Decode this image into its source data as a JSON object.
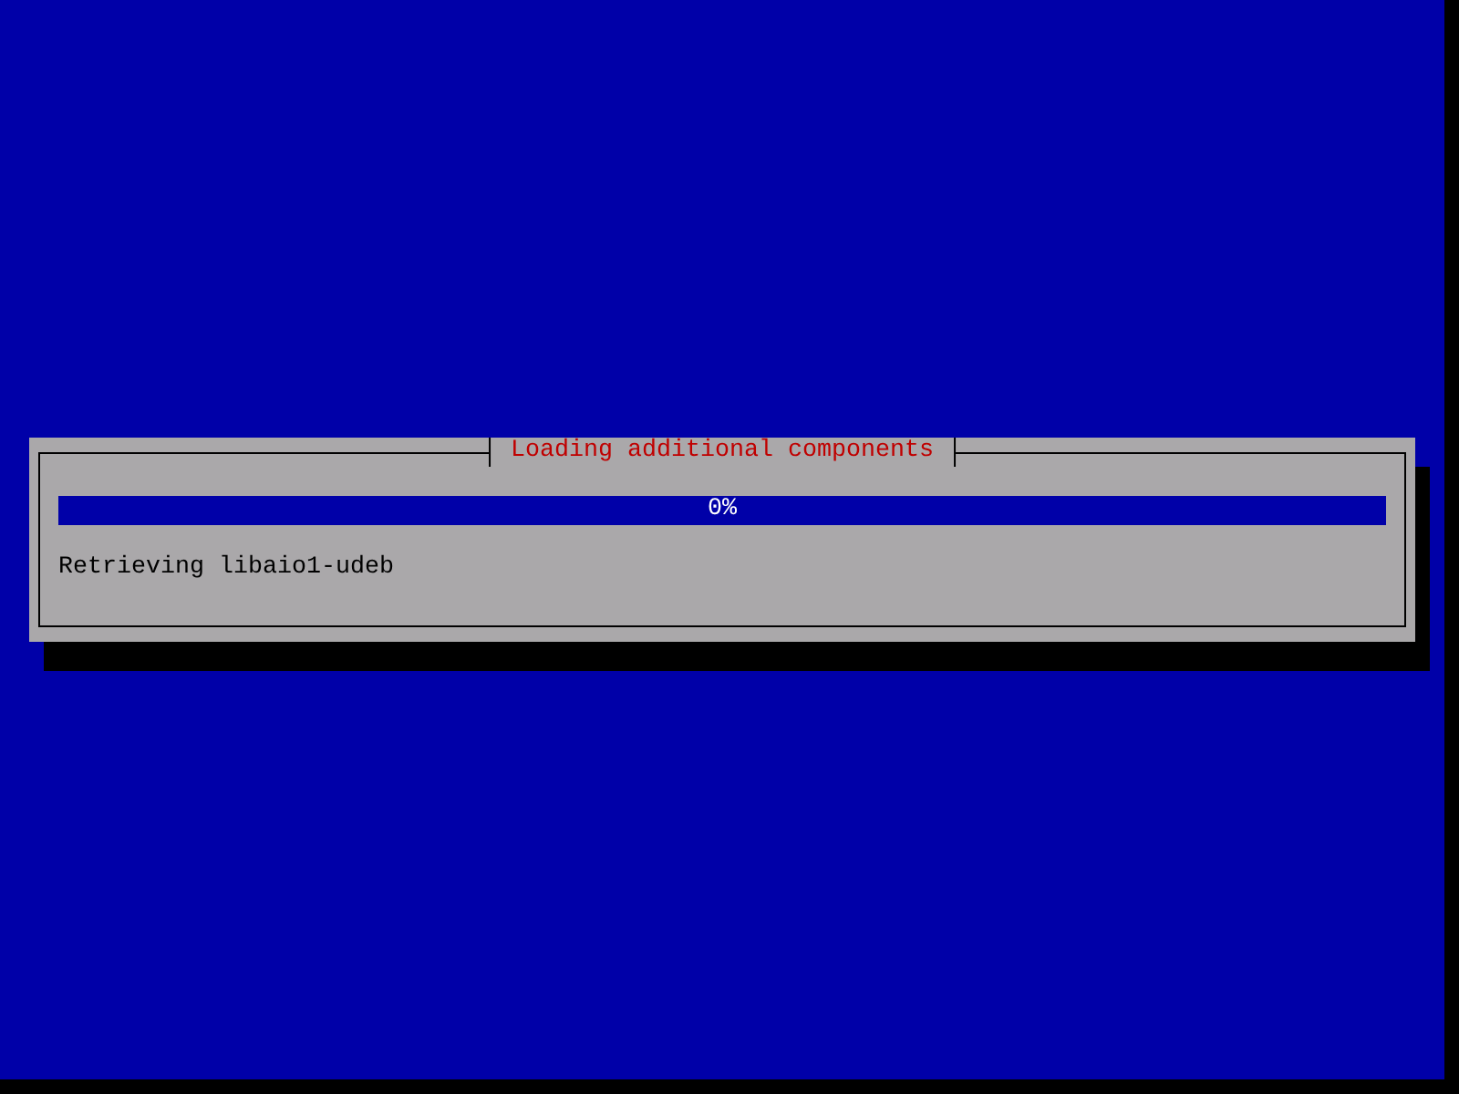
{
  "dialog": {
    "title": "Loading additional components"
  },
  "progress": {
    "level": 0,
    "reading": "0%"
  },
  "status": "Retrieving libaio1-udeb"
}
